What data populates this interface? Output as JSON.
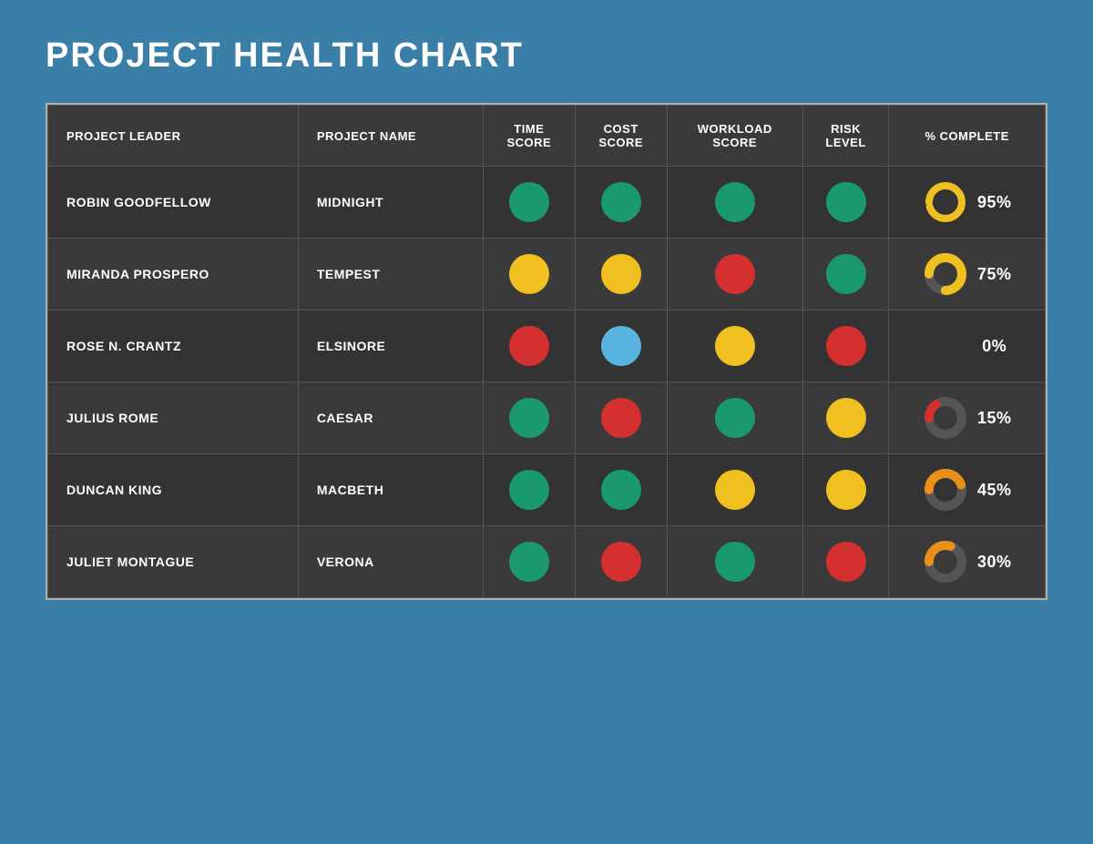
{
  "title": "PROJECT HEALTH CHART",
  "columns": {
    "col1": "PROJECT LEADER",
    "col2": "PROJECT NAME",
    "col3": "TIME\nSCORE",
    "col4": "COST\nSCORE",
    "col5": "WORKLOAD\nSCORE",
    "col6": "RISK\nLEVEL",
    "col7": "% COMPLETE"
  },
  "rows": [
    {
      "leader": "ROBIN GOODFELLOW",
      "project": "MIDNIGHT",
      "time": "green",
      "cost": "green",
      "workload": "green",
      "risk": "green",
      "percent": 95,
      "donut_color": "#f0c020"
    },
    {
      "leader": "MIRANDA PROSPERO",
      "project": "TEMPEST",
      "time": "yellow",
      "cost": "yellow",
      "workload": "red",
      "risk": "green",
      "percent": 75,
      "donut_color": "#f0c020"
    },
    {
      "leader": "ROSE N. CRANTZ",
      "project": "ELSINORE",
      "time": "red",
      "cost": "blue",
      "workload": "yellow",
      "risk": "red",
      "percent": 0,
      "donut_color": null
    },
    {
      "leader": "JULIUS ROME",
      "project": "CAESAR",
      "time": "green",
      "cost": "red",
      "workload": "green",
      "risk": "yellow",
      "percent": 15,
      "donut_color": "#d43030"
    },
    {
      "leader": "DUNCAN KING",
      "project": "MACBETH",
      "time": "green",
      "cost": "green",
      "workload": "yellow",
      "risk": "yellow",
      "percent": 45,
      "donut_color": "#e8901a"
    },
    {
      "leader": "JULIET MONTAGUE",
      "project": "VERONA",
      "time": "green",
      "cost": "red",
      "workload": "green",
      "risk": "red",
      "percent": 30,
      "donut_color": "#e8901a"
    }
  ],
  "colors": {
    "green": "#1a9a6c",
    "yellow": "#f0c020",
    "red": "#d43030",
    "blue": "#5ab4e0"
  }
}
